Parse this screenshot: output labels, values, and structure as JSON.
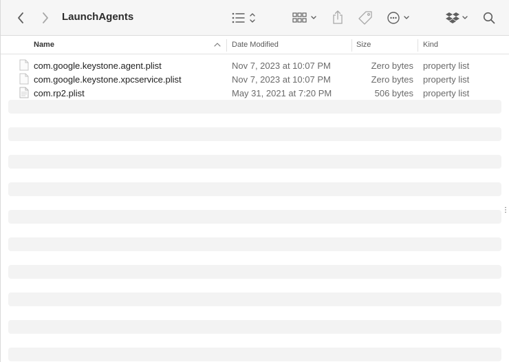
{
  "toolbar": {
    "title": "LaunchAgents",
    "icons": [
      "back-icon",
      "forward-icon",
      "list-view-icon",
      "group-icon",
      "share-icon",
      "tag-icon",
      "more-icon",
      "dropbox-icon",
      "search-icon"
    ]
  },
  "columns": {
    "name": "Name",
    "date": "Date Modified",
    "size": "Size",
    "kind": "Kind"
  },
  "files": [
    {
      "name": "com.google.keystone.agent.plist",
      "date": "Nov 7, 2023 at 10:07 PM",
      "size": "Zero bytes",
      "kind": "property list"
    },
    {
      "name": "com.google.keystone.xpcservice.plist",
      "date": "Nov 7, 2023 at 10:07 PM",
      "size": "Zero bytes",
      "kind": "property list"
    },
    {
      "name": "com.rp2.plist",
      "date": "May 31, 2021 at 7:20 PM",
      "size": "506 bytes",
      "kind": "property list"
    }
  ],
  "colors": {
    "toolbar_bg": "#f6f6f6",
    "stripe": "#f3f3f3",
    "icon": "#6e6e6e"
  }
}
